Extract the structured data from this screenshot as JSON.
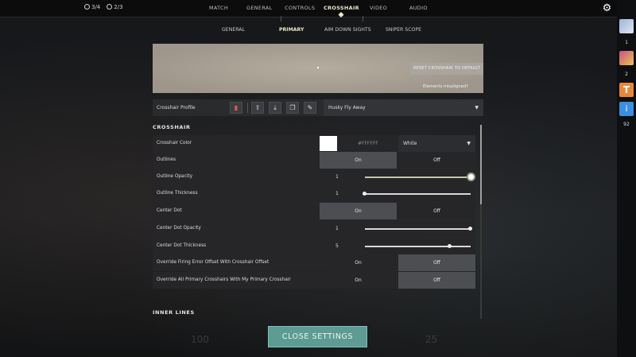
{
  "topbar": {
    "round_a": "3/4",
    "round_b": "2/3",
    "tabs": [
      "MATCH",
      "GENERAL",
      "CONTROLS",
      "CROSSHAIR",
      "VIDEO",
      "AUDIO"
    ],
    "active_tab": "CROSSHAIR"
  },
  "subtabs": [
    "GENERAL",
    "PRIMARY",
    "AIM DOWN SIGHTS",
    "SNIPER SCOPE"
  ],
  "sidebar": {
    "counts": [
      "1",
      "2",
      "92"
    ]
  },
  "preview": {
    "reset_label": "RESET CROSSHAIR TO DEFAULT",
    "misaligned": "Elements misaligned?"
  },
  "profile": {
    "label": "Crosshair Profile",
    "selected": "Husky Fly Away"
  },
  "section_crosshair": "CROSSHAIR",
  "section_inner": "INNER LINES",
  "settings": {
    "color": {
      "label": "Crosshair Color",
      "hex": "#FFFFFF",
      "value": "White",
      "swatch": "#ffffff"
    },
    "outlines": {
      "label": "Outlines",
      "on": "On",
      "off": "Off",
      "state": "On"
    },
    "outline_opacity": {
      "label": "Outline Opacity",
      "value": "1",
      "level": 1.0
    },
    "outline_thickness": {
      "label": "Outline Thickness",
      "value": "1",
      "level": 0.0
    },
    "center_dot": {
      "label": "Center Dot",
      "on": "On",
      "off": "Off",
      "state": "On"
    },
    "center_dot_opacity": {
      "label": "Center Dot Opacity",
      "value": "1",
      "level": 1.0
    },
    "center_dot_thickness": {
      "label": "Center Dot Thickness",
      "value": "5",
      "level": 0.8
    },
    "override_firing": {
      "label": "Override Firing Error Offset With Crosshair Offset",
      "on": "On",
      "off": "Off",
      "state": "Off"
    },
    "override_all": {
      "label": "Override All Primary Crosshairs With My Primary Crosshair",
      "on": "On",
      "off": "Off",
      "state": "Off"
    }
  },
  "close_label": "CLOSE SETTINGS",
  "ghost_left": "100",
  "ghost_right": "25"
}
